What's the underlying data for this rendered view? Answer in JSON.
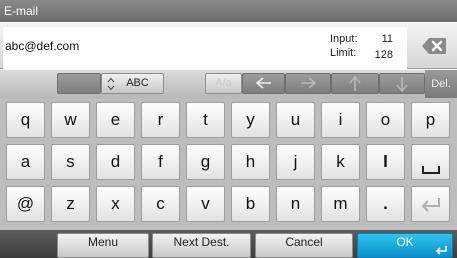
{
  "window": {
    "title": "E-mail"
  },
  "entry": {
    "value": "abc@def.com",
    "input_label": "Input:",
    "input_count": "11",
    "limit_label": "Limit:",
    "limit_count": "128",
    "backspace_icon": "backspace-icon"
  },
  "mode_bar": {
    "mode_label": "ABC",
    "case_label": "A/a",
    "arrows": [
      "arrow-left-icon",
      "arrow-right-icon",
      "arrow-up-icon",
      "arrow-down-icon"
    ],
    "del_label": "Del."
  },
  "keyboard": {
    "row1": [
      "q",
      "w",
      "e",
      "r",
      "t",
      "y",
      "u",
      "i",
      "o",
      "p"
    ],
    "row2": [
      "a",
      "s",
      "d",
      "f",
      "g",
      "h",
      "j",
      "k",
      "l"
    ],
    "row3": [
      "@",
      "z",
      "x",
      "c",
      "v",
      "b",
      "n",
      "m",
      "."
    ],
    "space_icon": "space-icon",
    "enter_icon": "enter-icon"
  },
  "bottom_bar": {
    "menu_label": "Menu",
    "next_dest_label": "Next Dest.",
    "cancel_label": "Cancel",
    "ok_label": "OK"
  },
  "colors": {
    "ok_button": "#1aa7dd",
    "title_bar": "#7b7b7b"
  }
}
